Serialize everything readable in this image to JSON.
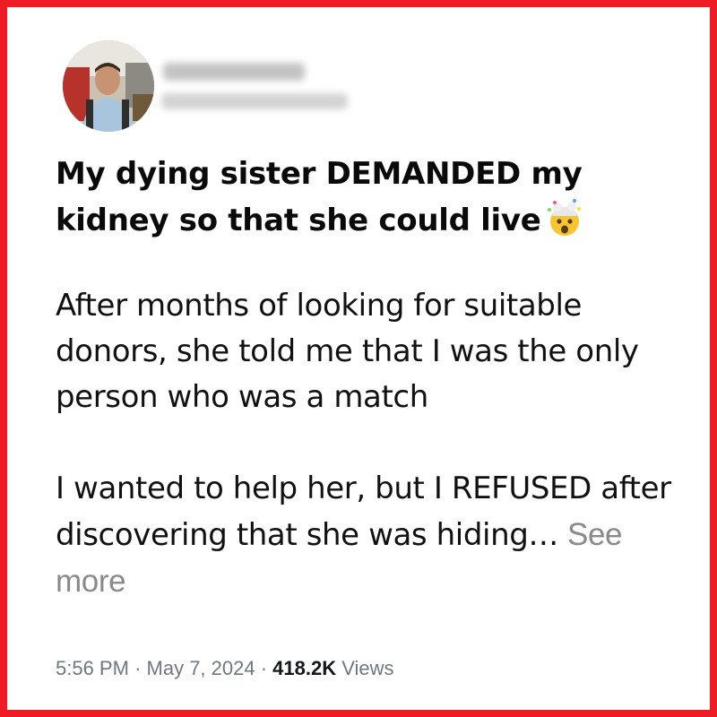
{
  "post": {
    "headline": "My dying sister DEMANDED my kidney so that she could live",
    "headline_emoji": "exploding-head-emoji",
    "paragraph1": "After months of looking for suitable donors, she told me that I was the only person who was a match",
    "paragraph2": "I wanted to help her, but I REFUSED after discovering that she was hiding…",
    "see_more": "See more"
  },
  "meta": {
    "time": "5:56 PM",
    "separator": "·",
    "date": "May 7, 2024",
    "views_count": "418.2K",
    "views_label": "Views"
  },
  "colors": {
    "border": "#ee1c24",
    "text": "#111111",
    "muted": "#6f7780",
    "see_more": "#8a8a8a"
  }
}
